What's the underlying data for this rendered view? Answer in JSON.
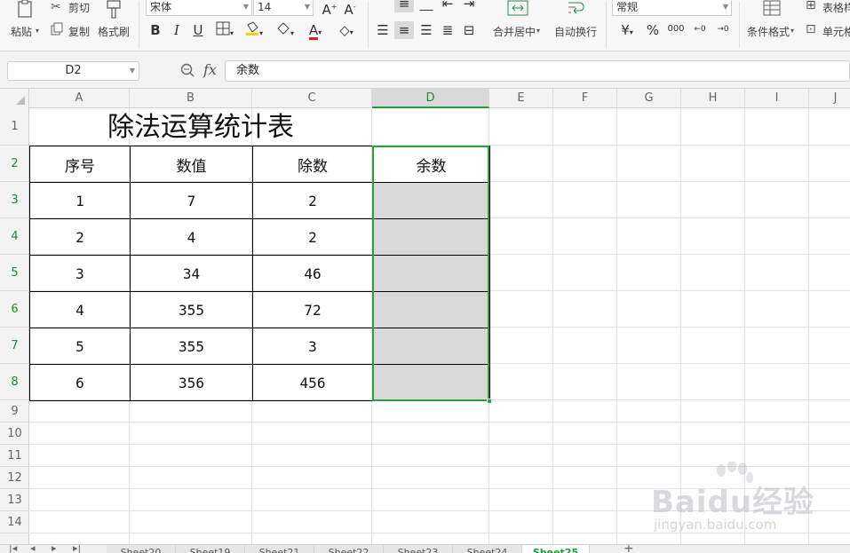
{
  "ribbon": {
    "paste": "粘贴",
    "cut": "剪切",
    "copy": "复制",
    "format_painter": "格式刷",
    "font_name": "宋体",
    "font_size": "14",
    "bold": "B",
    "italic": "I",
    "underline": "U",
    "merge_center": "合并居中",
    "wrap_text": "自动换行",
    "number_format": "常规",
    "currency": "¥",
    "percent": "%",
    "thousands": "000",
    "conditional_format": "条件格式",
    "table_style": "表格样",
    "cell_style": "单元格"
  },
  "formula_bar": {
    "name_box": "D2",
    "fx": "fx",
    "content": "余数"
  },
  "columns": [
    "A",
    "B",
    "C",
    "D",
    "E",
    "F",
    "G",
    "H",
    "I",
    "J"
  ],
  "rows": [
    "1",
    "2",
    "3",
    "4",
    "5",
    "6",
    "7",
    "8",
    "9",
    "10",
    "11",
    "12",
    "13",
    "14"
  ],
  "sheet": {
    "title": "除法运算统计表",
    "headers": [
      "序号",
      "数值",
      "除数",
      "余数"
    ],
    "data": [
      [
        "1",
        "7",
        "2"
      ],
      [
        "2",
        "4",
        "2"
      ],
      [
        "3",
        "34",
        "46"
      ],
      [
        "4",
        "355",
        "72"
      ],
      [
        "5",
        "355",
        "3"
      ],
      [
        "6",
        "356",
        "456"
      ]
    ]
  },
  "tabs": [
    "Sheet20",
    "Sheet19",
    "Sheet21",
    "Sheet22",
    "Sheet23",
    "Sheet24",
    "Sheet25"
  ],
  "watermark": {
    "brand": "Baidu经验",
    "url": "jingyan.baidu.com"
  },
  "colors": {
    "selection": "#2ea043",
    "selected_fill": "#d9d9d9",
    "font_color_bar": "#e02020"
  }
}
